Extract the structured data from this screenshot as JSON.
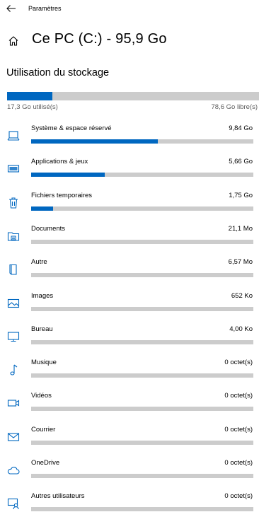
{
  "topbar": {
    "title": "Paramètres"
  },
  "header": {
    "title": "Ce PC (C:) - 95,9 Go"
  },
  "storage": {
    "section_title": "Utilisation du stockage",
    "used_label": "17,3 Go utilisé(s)",
    "free_label": "78,6 Go libre(s)",
    "used_fraction": 0.18
  },
  "accent_color": "#0067c0",
  "categories": [
    {
      "name": "Système & espace réservé",
      "size": "9,84 Go",
      "fraction": 0.57,
      "icon": "computer-icon"
    },
    {
      "name": "Applications & jeux",
      "size": "5,66 Go",
      "fraction": 0.33,
      "icon": "keyboard-icon"
    },
    {
      "name": "Fichiers temporaires",
      "size": "1,75 Go",
      "fraction": 0.1,
      "icon": "trash-icon"
    },
    {
      "name": "Documents",
      "size": "21,1 Mo",
      "fraction": 0,
      "icon": "documents-folder-icon"
    },
    {
      "name": "Autre",
      "size": "6,57 Mo",
      "fraction": 0,
      "icon": "book-icon"
    },
    {
      "name": "Images",
      "size": "652 Ko",
      "fraction": 0,
      "icon": "picture-icon"
    },
    {
      "name": "Bureau",
      "size": "4,00 Ko",
      "fraction": 0,
      "icon": "monitor-icon"
    },
    {
      "name": "Musique",
      "size": "0 octet(s)",
      "fraction": 0,
      "icon": "music-note-icon"
    },
    {
      "name": "Vidéos",
      "size": "0 octet(s)",
      "fraction": 0,
      "icon": "video-camera-icon"
    },
    {
      "name": "Courrier",
      "size": "0 octet(s)",
      "fraction": 0,
      "icon": "mail-icon"
    },
    {
      "name": "OneDrive",
      "size": "0 octet(s)",
      "fraction": 0,
      "icon": "cloud-icon"
    },
    {
      "name": "Autres utilisateurs",
      "size": "0 octet(s)",
      "fraction": 0,
      "icon": "other-users-icon"
    }
  ]
}
